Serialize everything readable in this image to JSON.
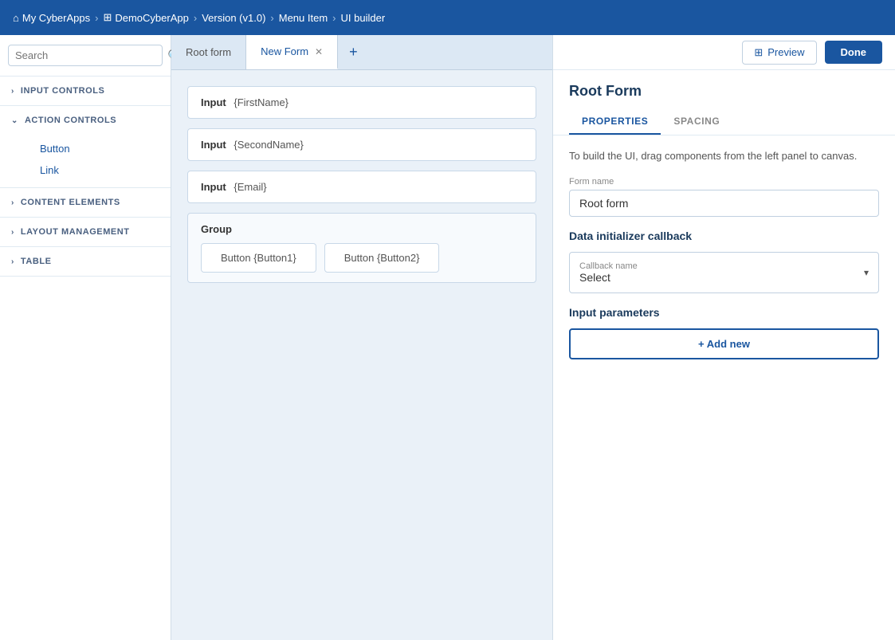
{
  "nav": {
    "items": [
      {
        "label": "My CyberApps",
        "icon": "home"
      },
      {
        "label": "DemoCyberApp",
        "icon": "grid"
      },
      {
        "label": "Version (v1.0)",
        "icon": null
      },
      {
        "label": "Menu Item",
        "icon": null
      },
      {
        "label": "UI builder",
        "icon": null
      }
    ]
  },
  "sidebar": {
    "search_placeholder": "Search",
    "sections": [
      {
        "label": "INPUT CONTROLS",
        "expanded": false,
        "items": []
      },
      {
        "label": "ACTION CONTROLS",
        "expanded": true,
        "items": [
          "Button",
          "Link"
        ]
      },
      {
        "label": "CONTENT ELEMENTS",
        "expanded": false,
        "items": []
      },
      {
        "label": "LAYOUT MANAGEMENT",
        "expanded": false,
        "items": []
      },
      {
        "label": "TABLE",
        "expanded": false,
        "items": []
      }
    ]
  },
  "tabs": [
    {
      "label": "Root form",
      "active": false,
      "closeable": false
    },
    {
      "label": "New Form",
      "active": true,
      "closeable": true
    }
  ],
  "tab_add_label": "+",
  "canvas": {
    "fields": [
      {
        "label": "Input",
        "value": "{FirstName}"
      },
      {
        "label": "Input",
        "value": "{SecondName}"
      },
      {
        "label": "Input",
        "value": "{Email}"
      }
    ],
    "group": {
      "label": "Group",
      "buttons": [
        {
          "label": "Button",
          "value": "{Button1}"
        },
        {
          "label": "Button",
          "value": "{Button2}"
        }
      ]
    }
  },
  "right_panel": {
    "title": "Root Form",
    "tabs": [
      {
        "label": "PROPERTIES",
        "active": true
      },
      {
        "label": "SPACING",
        "active": false
      }
    ],
    "helper_text": "To build the UI, drag components from the left panel to canvas.",
    "form_name_label": "Form name",
    "form_name_value": "Root form",
    "data_initializer_title": "Data initializer callback",
    "callback_label": "Callback name",
    "callback_value": "Select",
    "input_params_title": "Input parameters",
    "add_new_label": "+ Add new",
    "preview_label": "Preview",
    "done_label": "Done"
  }
}
